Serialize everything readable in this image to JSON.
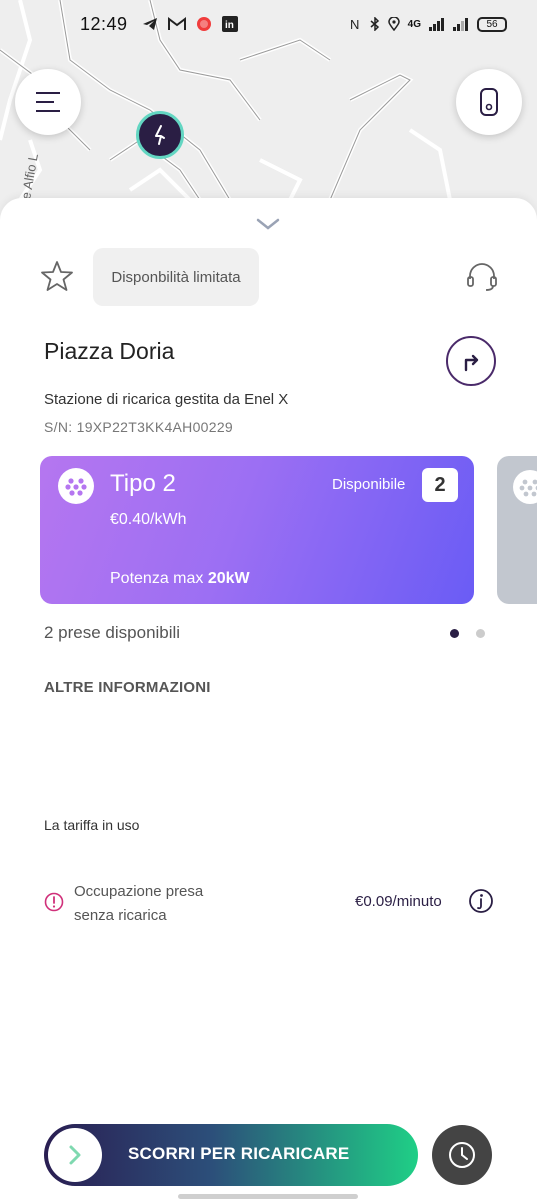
{
  "status_bar": {
    "time": "12:49",
    "network": "4G",
    "battery": "56"
  },
  "map": {
    "street_label": "e Alfio L"
  },
  "station": {
    "availability_badge": "Disponbilità limitata",
    "name": "Piazza Doria",
    "operator": "Stazione di ricarica gestita da Enel X",
    "serial": "S/N: 19XP22T3KK4AH00229"
  },
  "connector_card": {
    "type": "Tipo 2",
    "price": "€0.40/kWh",
    "power_label": "Potenza max",
    "power_value": "20kW",
    "status": "Disponibile",
    "count": "2"
  },
  "available_sockets": "2 prese disponibili",
  "carousel": {
    "pages": 2,
    "active_page": 1
  },
  "more_info": {
    "heading": "ALTRE INFORMAZIONI",
    "tariff_label": "La tariffa in uso",
    "occupation_line1": "Occupazione presa",
    "occupation_line2": "senza ricarica",
    "occupation_price": "€0.09/minuto"
  },
  "slide_button": {
    "label": "SCORRI PER RICARICARE"
  },
  "colors": {
    "brand_dark": "#2a1e44",
    "card_gradient_start": "#b576f0",
    "card_gradient_end": "#6a5cf5",
    "slide_gradient_end": "#1fcf86",
    "pin_ring": "#63d6c2",
    "alert": "#d0307a"
  },
  "icons": [
    "menu-icon",
    "phone-icon",
    "charging-pin-icon",
    "chevron-down-icon",
    "star-icon",
    "headset-icon",
    "turn-right-icon",
    "plug-icon",
    "alert-circle-icon",
    "info-icon",
    "chevron-right-icon",
    "clock-icon"
  ]
}
